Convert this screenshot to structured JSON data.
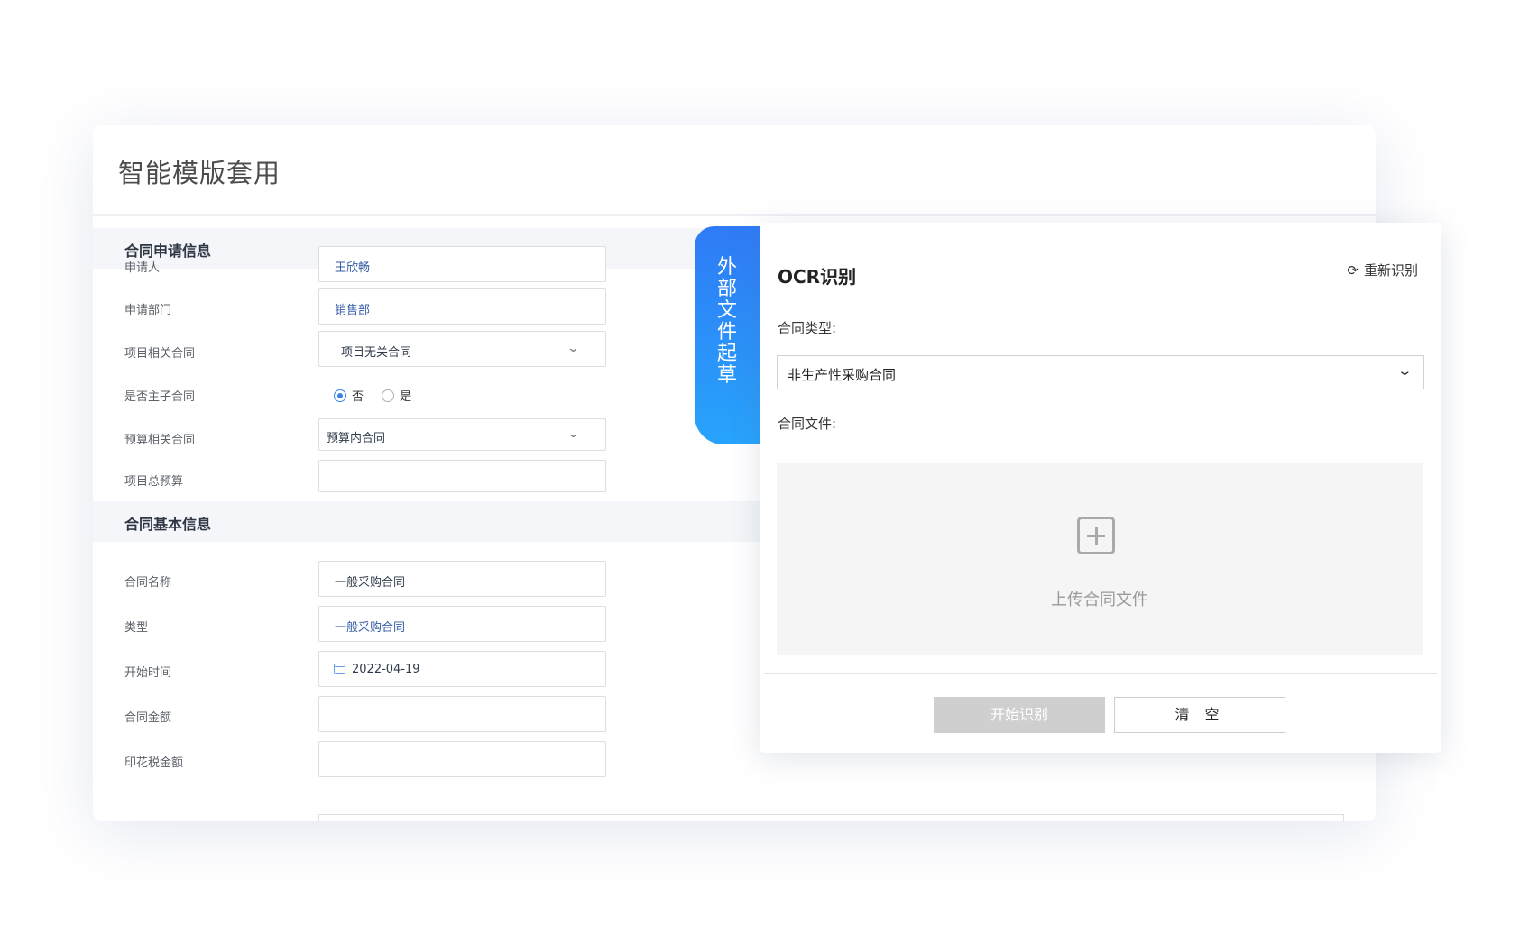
{
  "page": {
    "title": "智能模版套用"
  },
  "sections": {
    "apply_info": "合同申请信息",
    "basic_info": "合同基本信息"
  },
  "fields": {
    "applicant": {
      "label": "申请人",
      "value": "王欣畅"
    },
    "department": {
      "label": "申请部门",
      "value": "销售部"
    },
    "project_related": {
      "label": "项目相关合同",
      "value": "项目无关合同"
    },
    "is_master": {
      "label": "是否主子合同",
      "options": [
        "否",
        "是"
      ],
      "selected": "否"
    },
    "budget_related": {
      "label": "预算相关合同",
      "value": "预算内合同"
    },
    "project_budget": {
      "label": "项目总预算",
      "value": ""
    },
    "contract_name": {
      "label": "合同名称",
      "value": "一般采购合同"
    },
    "type": {
      "label": "类型",
      "value": "一般采购合同"
    },
    "start_date": {
      "label": "开始时间",
      "value": "2022-04-19"
    },
    "amount": {
      "label": "合同金额",
      "value": ""
    },
    "stamp_tax": {
      "label": "印花税金额",
      "value": ""
    }
  },
  "side_tab": {
    "chars": [
      "外",
      "部",
      "文",
      "件",
      "起",
      "草"
    ]
  },
  "ocr": {
    "title": "OCR识别",
    "refresh_label": "重新识别",
    "contract_type_label": "合同类型:",
    "contract_type_value": "非生产性采购合同",
    "contract_file_label": "合同文件:",
    "upload_label": "上传合同文件",
    "start_button": "开始识别",
    "clear_button": "清 空"
  },
  "colors": {
    "accent": "#2f7bf6",
    "accent_end": "#27a4fc",
    "link_blue": "#345aa5"
  },
  "icons": {
    "chevron": "chevron-down-icon",
    "refresh": "refresh-icon",
    "calendar": "calendar-icon",
    "upload": "plus-square-icon"
  }
}
